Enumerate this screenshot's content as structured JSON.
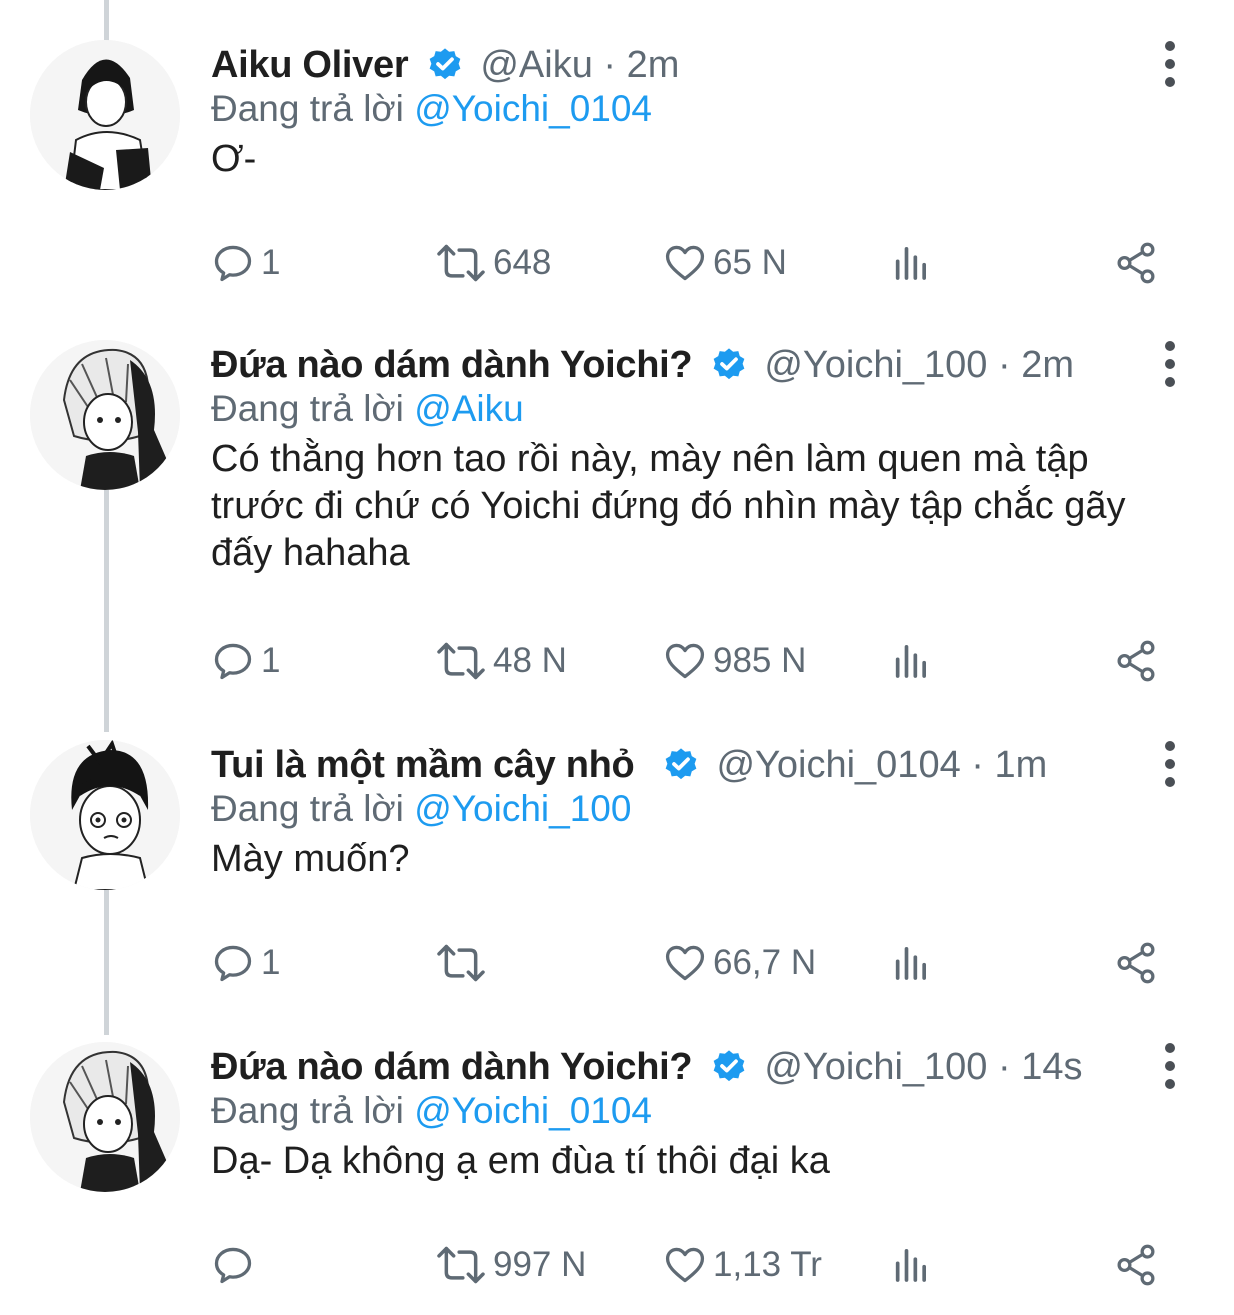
{
  "thread": {
    "tweets": [
      {
        "name": "Aiku Oliver",
        "handle": "@Aiku",
        "time": "2m",
        "reply_prefix": "Đang trả lời",
        "reply_to": "@Yoichi_0104",
        "text": "Ơ-",
        "reply_count": "1",
        "retweet_count": "648",
        "like_count": "65 N",
        "avatar": "avatar-aiku"
      },
      {
        "name": "Đứa nào dám dành Yoichi?",
        "handle": "@Yoichi_100",
        "time": "2m",
        "reply_prefix": "Đang trả lời",
        "reply_to": "@Aiku",
        "text": "Có thằng hơn tao rồi này, mày nên làm quen mà tập trước đi chứ có Yoichi đứng đó nhìn mày tập chắc gãy đấy hahaha",
        "reply_count": "1",
        "retweet_count": "48 N",
        "like_count": "985 N",
        "avatar": "avatar-yoichi-100"
      },
      {
        "name": "Tui là một mầm cây nhỏ",
        "handle": "@Yoichi_0104",
        "time": "1m",
        "reply_prefix": "Đang trả lời",
        "reply_to": "@Yoichi_100",
        "text": "Mày muốn?",
        "reply_count": "1",
        "retweet_count": "",
        "like_count": "66,7 N",
        "avatar": "avatar-yoichi-0104"
      },
      {
        "name": "Đứa nào dám dành Yoichi?",
        "handle": "@Yoichi_100",
        "time": "14s",
        "reply_prefix": "Đang trả lời",
        "reply_to": "@Yoichi_0104",
        "text": "Dạ- Dạ không ạ em đùa tí thôi đại ka",
        "reply_count": "",
        "retweet_count": "997 N",
        "like_count": "1,13 Tr",
        "avatar": "avatar-yoichi-100"
      }
    ]
  },
  "colors": {
    "link": "#1d9bf0",
    "verified": "#1d9bf0",
    "secondary_text": "#5f6a74",
    "primary_text": "#1f1f1f",
    "thread_line": "#cfd4d8"
  },
  "icons": {
    "reply": "reply-icon",
    "retweet": "retweet-icon",
    "like": "heart-icon",
    "views": "views-icon",
    "share": "share-icon",
    "more": "more-vertical-icon",
    "verified": "verified-badge-icon"
  }
}
